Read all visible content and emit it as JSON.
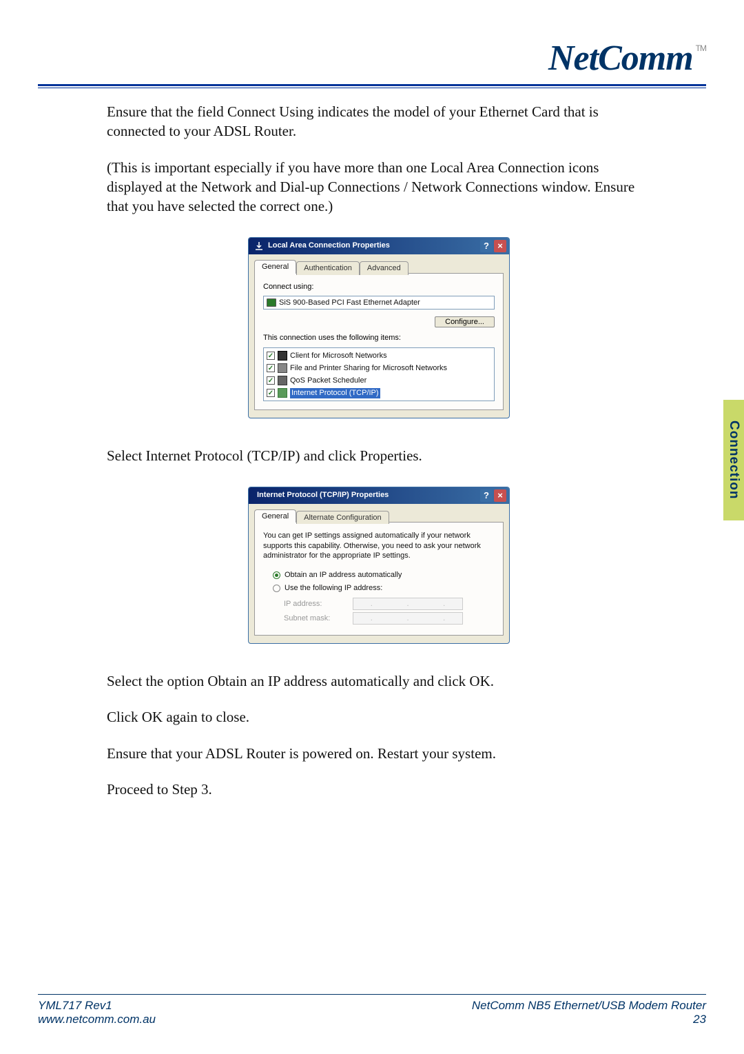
{
  "logo": {
    "text": "NetComm",
    "tm": "TM"
  },
  "paragraphs": {
    "p1": "Ensure that the field Connect Using indicates the model of your Ethernet Card that is connected to your ADSL Router.",
    "p2": "(This is important especially if you have more than one Local Area Connection icons displayed at the Network and Dial-up Connections / Network Connections window. Ensure that you have selected the correct one.)",
    "p3": "Select Internet Protocol (TCP/IP) and click Properties.",
    "p4": "Select the option Obtain an IP address automatically and click OK.",
    "p5": "Click OK again to close.",
    "p6": "Ensure that your ADSL Router is powered on.  Restart your system.",
    "p7": "Proceed to Step 3."
  },
  "dialog1": {
    "title": "Local Area Connection Properties",
    "tabs": [
      "General",
      "Authentication",
      "Advanced"
    ],
    "connect_using_label": "Connect using:",
    "adapter": "SiS 900-Based PCI Fast Ethernet Adapter",
    "configure_btn": "Configure...",
    "items_label": "This connection uses the following items:",
    "items": [
      "Client for Microsoft Networks",
      "File and Printer Sharing for Microsoft Networks",
      "QoS Packet Scheduler",
      "Internet Protocol (TCP/IP)"
    ]
  },
  "dialog2": {
    "title": "Internet Protocol (TCP/IP) Properties",
    "tabs": [
      "General",
      "Alternate Configuration"
    ],
    "info": "You can get IP settings assigned automatically if your network supports this capability. Otherwise, you need to ask your network administrator for the appropriate IP settings.",
    "radio1": "Obtain an IP address automatically",
    "radio2": "Use the following IP address:",
    "ip_label": "IP address:",
    "subnet_label": "Subnet mask:"
  },
  "side_tab": "Connection",
  "footer": {
    "doc_id": "YML717 Rev1",
    "url": "www.netcomm.com.au",
    "product": "NetComm NB5 Ethernet/USB Modem Router",
    "page": "23"
  }
}
